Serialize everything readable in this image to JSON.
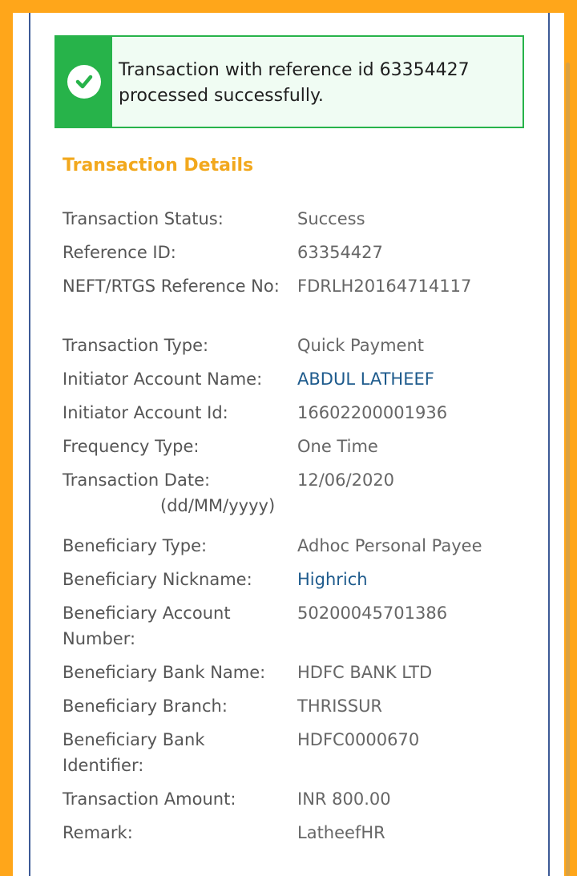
{
  "alert": {
    "message": "Transaction with reference id 63354427 processed successfully.",
    "icon": "check-circle-icon",
    "color": "#27b34a"
  },
  "section": {
    "title": "Transaction Details",
    "title_color": "#f2a81d"
  },
  "details": {
    "status": {
      "label": "Transaction Status:",
      "value": "Success"
    },
    "reference_id": {
      "label": "Reference ID:",
      "value": "63354427"
    },
    "neft_ref": {
      "label": "NEFT/RTGS Reference No:",
      "value": "FDRLH20164714117"
    },
    "txn_type": {
      "label": "Transaction Type:",
      "value": "Quick Payment"
    },
    "initiator_name": {
      "label": "Initiator Account Name:",
      "value": "ABDUL LATHEEF"
    },
    "initiator_id": {
      "label": "Initiator Account Id:",
      "value": "16602200001936"
    },
    "frequency": {
      "label": "Frequency Type:",
      "value": "One Time"
    },
    "txn_date": {
      "label": "Transaction Date:",
      "sublabel": "(dd/MM/yyyy)",
      "value": "12/06/2020"
    },
    "beneficiary_type": {
      "label": "Beneficiary Type:",
      "value": "Adhoc Personal Payee"
    },
    "beneficiary_nickname": {
      "label": "Beneficiary Nickname:",
      "value": "Highrich"
    },
    "beneficiary_account": {
      "label": "Beneficiary Account Number:",
      "value": "50200045701386"
    },
    "beneficiary_bank": {
      "label": "Beneficiary Bank Name:",
      "value": "HDFC BANK LTD"
    },
    "beneficiary_branch": {
      "label": "Beneficiary Branch:",
      "value": "THRISSUR"
    },
    "beneficiary_ifsc": {
      "label": "Beneficiary Bank Identifier:",
      "value": "HDFC0000670"
    },
    "amount": {
      "label": "Transaction Amount:",
      "value": "INR 800.00"
    },
    "remark": {
      "label": "Remark:",
      "value": "LatheefHR"
    }
  }
}
